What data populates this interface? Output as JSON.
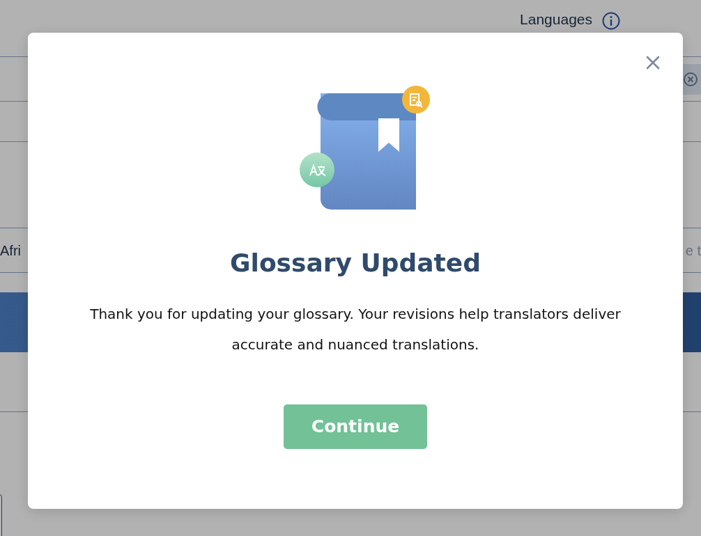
{
  "background": {
    "languages_label": "Languages",
    "row_text": "Afri",
    "placeholder": "e t"
  },
  "dialog": {
    "title": "Glossary Updated",
    "message": "Thank you for updating your glossary. Your revisions help translators deliver accurate and nuanced translations.",
    "button": "Continue"
  }
}
